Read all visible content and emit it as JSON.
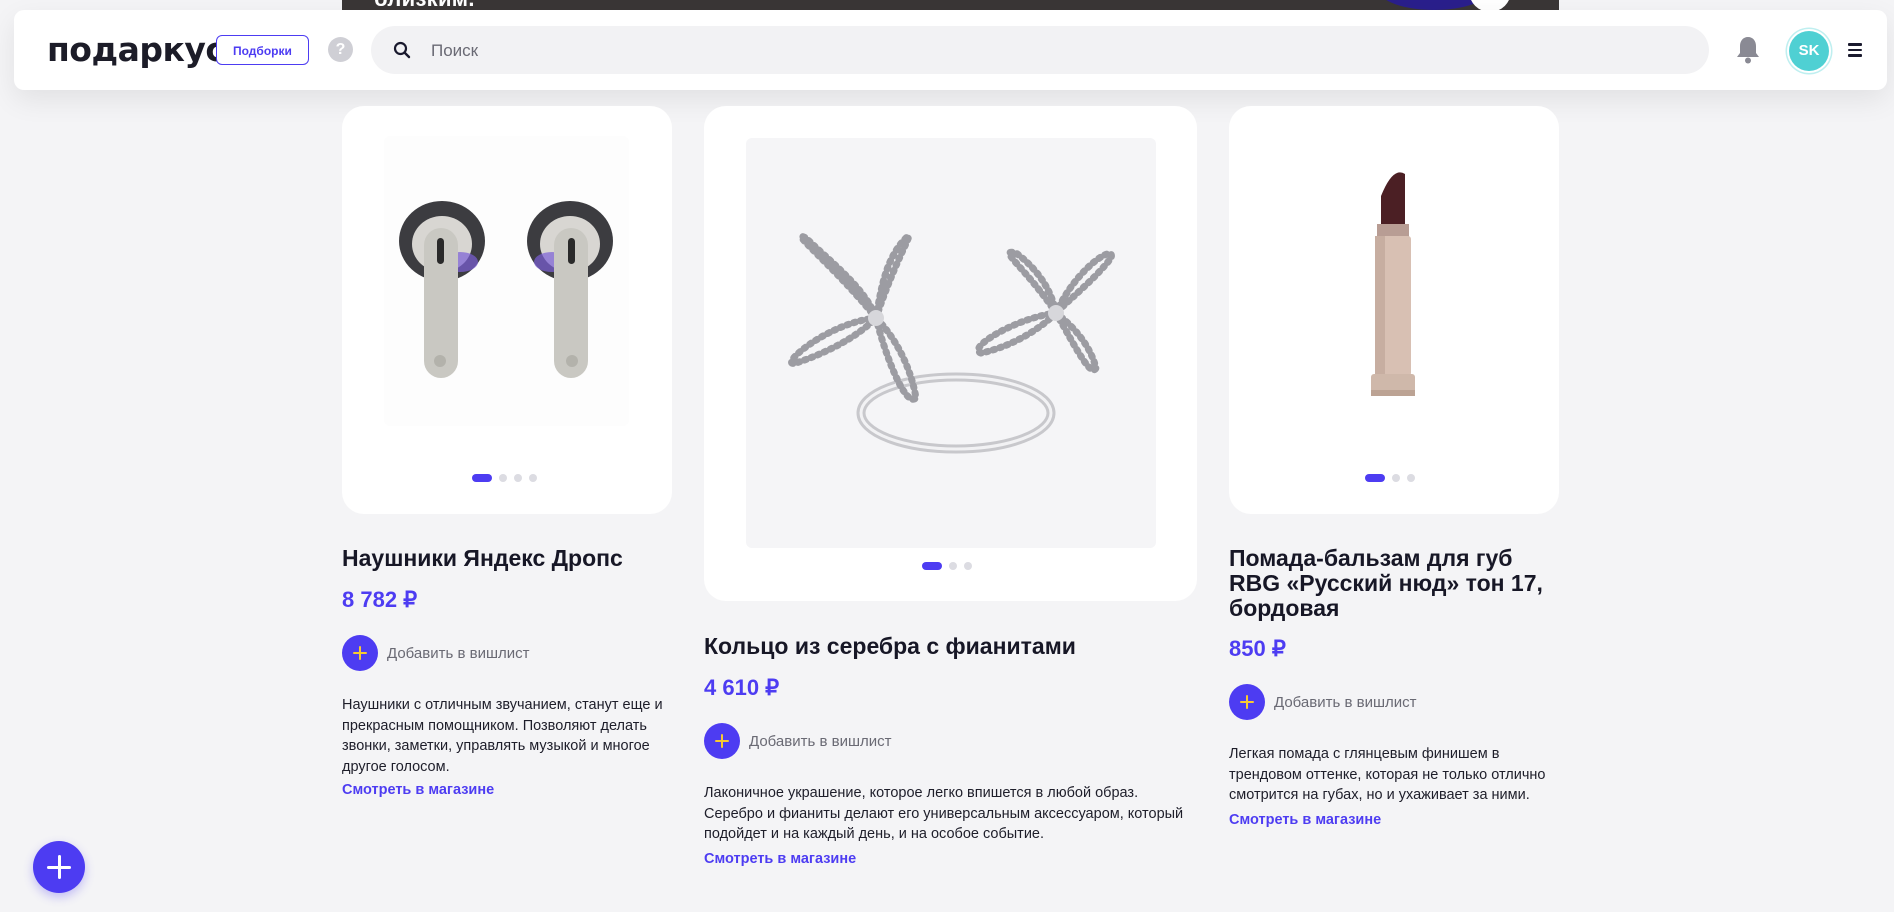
{
  "banner": {
    "text": "близким."
  },
  "header": {
    "logo": "подаркус",
    "collections_label": "Подборки",
    "help_icon": "question-icon",
    "search_placeholder": "Поиск",
    "avatar_initials": "SK"
  },
  "products": [
    {
      "title": "Наушники Яндекс Дропс",
      "price": "8 782 ₽",
      "wishlist_label": "Добавить в вишлист",
      "description": "Наушники с отличным звучанием, станут еще и прекрасным помощником. Позволяют делать звонки, заметки, управлять музыкой и многое другое голосом.",
      "shop_link": "Смотреть в магазине",
      "slides": 4,
      "active_slide": 1
    },
    {
      "title": "Кольцо из серебра с фианитами",
      "price": "4 610 ₽",
      "wishlist_label": "Добавить в вишлист",
      "description": "Лаконичное украшение, которое легко впишется в любой образ. Серебро и фианиты делают его универсальным аксессуаром, который подойдет и на каждый день, и на особое событие.",
      "shop_link": "Смотреть в магазине",
      "slides": 3,
      "active_slide": 1
    },
    {
      "title": "Помада-бальзам для губ RBG «Русский нюд» тон 17, бордовая",
      "price": "850 ₽",
      "wishlist_label": "Добавить в вишлист",
      "description": "Легкая помада с глянцевым финишем в трендовом оттенке, которая не только отлично смотрится на губах, но и ухаживает за ними.",
      "shop_link": "Смотреть в магазине",
      "slides": 3,
      "active_slide": 1
    }
  ],
  "colors": {
    "accent": "#4d3cf2",
    "plus_cross": "#f7c933",
    "avatar": "#4fd0d3",
    "background": "#f4f4f6"
  }
}
